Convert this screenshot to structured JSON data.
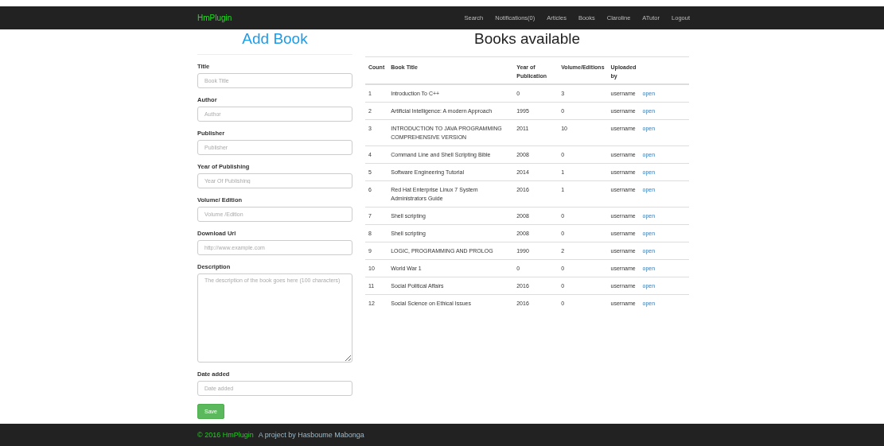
{
  "navbar": {
    "brand": "HmPlugin",
    "links": [
      "Search",
      "Notifications(0)",
      "Articles",
      "Books",
      "Claroline",
      "ATutor",
      "Logout"
    ]
  },
  "form": {
    "title": "Add Book",
    "fields": [
      {
        "label": "Title",
        "placeholder": "Book Title",
        "kind": "input"
      },
      {
        "label": "Author",
        "placeholder": "Author",
        "kind": "input"
      },
      {
        "label": "Publisher",
        "placeholder": "Publisher",
        "kind": "input"
      },
      {
        "label": "Year of Publishing",
        "placeholder": "Year Of Publishing",
        "kind": "input"
      },
      {
        "label": "Volume/ Edition",
        "placeholder": "Volume /Edition",
        "kind": "input"
      },
      {
        "label": "Download Url",
        "placeholder": "http://www.example.com",
        "kind": "input"
      },
      {
        "label": "Description",
        "placeholder": "The description of the book goes here (100 characters)",
        "kind": "textarea"
      },
      {
        "label": "Date added",
        "placeholder": "Date added",
        "kind": "input"
      }
    ],
    "save_button": "Save"
  },
  "books": {
    "title": "Books available",
    "columns": [
      "Count",
      "Book Title",
      "Year of Publication",
      "Volume/Editions",
      "Uploaded by"
    ],
    "rows": [
      {
        "count": "1",
        "title": "Introduction To C++",
        "year": "0",
        "volume": "3",
        "uploaded_by": "username",
        "link": "open"
      },
      {
        "count": "2",
        "title": "Artificial Intelligence: A modern Approach",
        "year": "1995",
        "volume": "0",
        "uploaded_by": "username",
        "link": "open"
      },
      {
        "count": "3",
        "title": "INTRODUCTION TO JAVA PROGRAMMING COMPREHENSIVE VERSION",
        "year": "2011",
        "volume": "10",
        "uploaded_by": "username",
        "link": "open"
      },
      {
        "count": "4",
        "title": "Command Line and Shell Scripting Bible",
        "year": "2008",
        "volume": "0",
        "uploaded_by": "username",
        "link": "open"
      },
      {
        "count": "5",
        "title": "Software Engineering Tutorial",
        "year": "2014",
        "volume": "1",
        "uploaded_by": "username",
        "link": "open"
      },
      {
        "count": "6",
        "title": "Red Hat Enterprise Linux 7 System Administrators Guide",
        "year": "2016",
        "volume": "1",
        "uploaded_by": "username",
        "link": "open"
      },
      {
        "count": "7",
        "title": "Shell scripting",
        "year": "2008",
        "volume": "0",
        "uploaded_by": "username",
        "link": "open"
      },
      {
        "count": "8",
        "title": "Shell scripting",
        "year": "2008",
        "volume": "0",
        "uploaded_by": "username",
        "link": "open"
      },
      {
        "count": "9",
        "title": "LOGIC, PROGRAMMING AND PROLOG",
        "year": "1990",
        "volume": "2",
        "uploaded_by": "username",
        "link": "open"
      },
      {
        "count": "10",
        "title": "World War 1",
        "year": "0",
        "volume": "0",
        "uploaded_by": "username",
        "link": "open"
      },
      {
        "count": "11",
        "title": "Social Political Affairs",
        "year": "2016",
        "volume": "0",
        "uploaded_by": "username",
        "link": "open"
      },
      {
        "count": "12",
        "title": "Social Science on Ethical Issues",
        "year": "2016",
        "volume": "0",
        "uploaded_by": "username",
        "link": "open"
      }
    ]
  },
  "footer": {
    "copyright": "© 2016 HmPlugin",
    "credit": "A project by Hasboume Mabonga"
  }
}
